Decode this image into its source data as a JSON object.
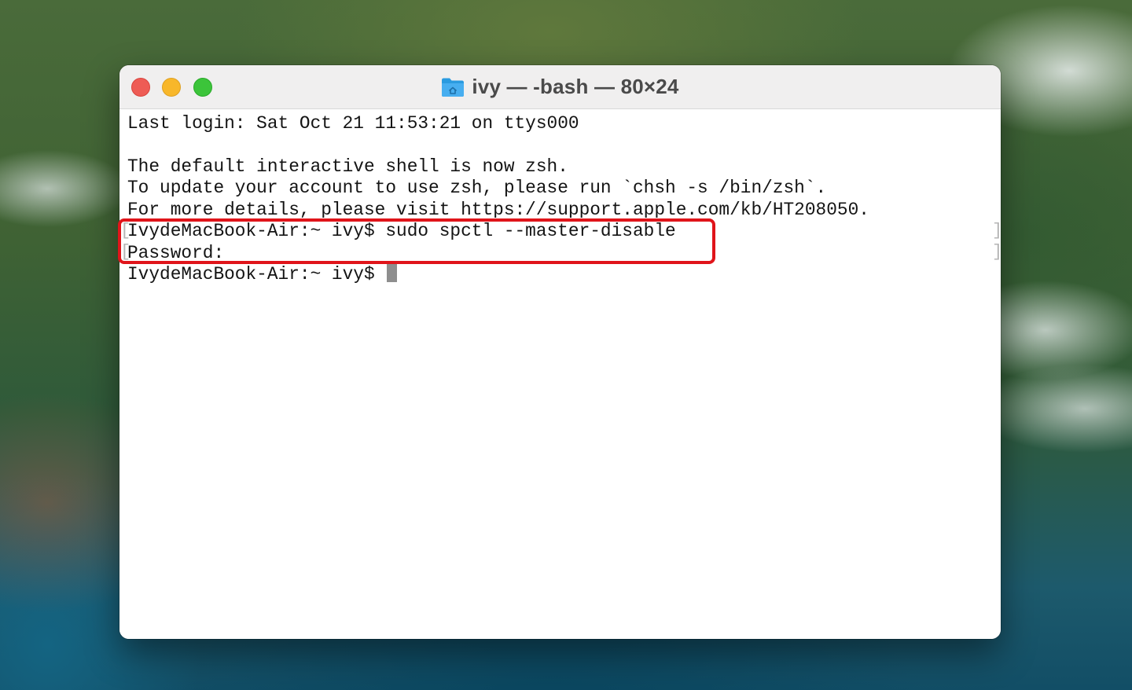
{
  "window": {
    "title": "ivy — -bash — 80×24",
    "folder_icon": "home-folder-icon",
    "traffic_lights": {
      "close": "#ee5c55",
      "minimize": "#f8b72a",
      "zoom": "#3cc43a"
    }
  },
  "terminal": {
    "lines": [
      "Last login: Sat Oct 21 11:53:21 on ttys000",
      "",
      "The default interactive shell is now zsh.",
      "To update your account to use zsh, please run `chsh -s /bin/zsh`.",
      "For more details, please visit https://support.apple.com/kb/HT208050.",
      "IvydeMacBook-Air:~ ivy$ sudo spctl --master-disable",
      "Password:",
      "IvydeMacBook-Air:~ ivy$ "
    ],
    "highlight_color": "#e0141a"
  }
}
